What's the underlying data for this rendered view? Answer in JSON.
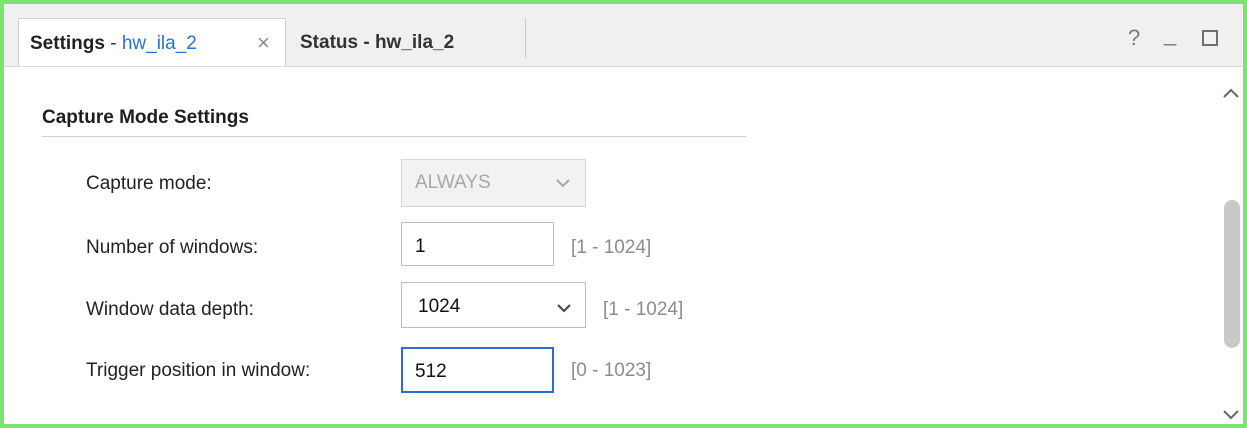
{
  "tabs": {
    "active": {
      "title": "Settings",
      "separator": " - ",
      "subtitle": "hw_ila_2",
      "close_glyph": "×"
    },
    "inactive": {
      "title": "Status - hw_ila_2"
    }
  },
  "window_controls": {
    "help": "?",
    "minimize": "_",
    "maximize_icon": "maximize-icon"
  },
  "section": {
    "title": "Capture Mode Settings"
  },
  "fields": {
    "capture_mode": {
      "label": "Capture mode:",
      "value": "ALWAYS",
      "disabled": true
    },
    "num_windows": {
      "label": "Number of windows:",
      "value": "1",
      "range": "[1 - 1024]"
    },
    "window_depth": {
      "label": "Window data depth:",
      "value": "1024",
      "range": "[1 - 1024]"
    },
    "trigger_position": {
      "label": "Trigger position in window:",
      "value": "512",
      "range": "[0 - 1023]",
      "focused": true
    }
  },
  "colors": {
    "frame_border": "#7be36f",
    "link_blue": "#2a6fd6",
    "focus_blue": "#2f6bd3",
    "range_gray": "#8c8c8c"
  }
}
